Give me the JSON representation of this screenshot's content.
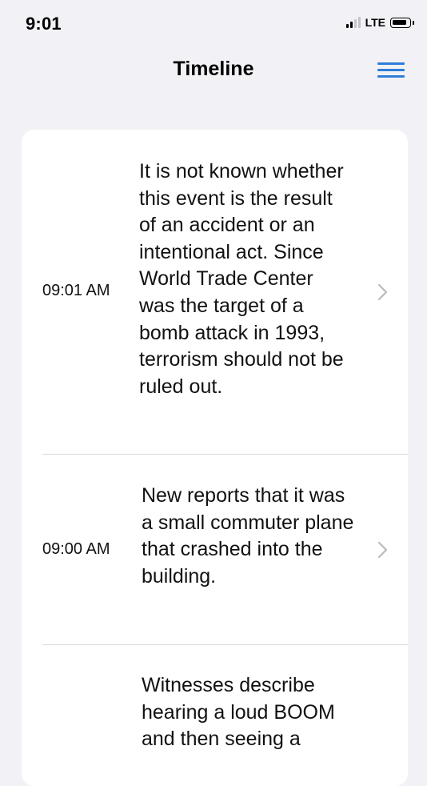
{
  "status_bar": {
    "time": "9:01",
    "network": "LTE"
  },
  "nav": {
    "title": "Timeline",
    "menu_icon": "hamburger-menu-icon",
    "accent_color": "#2f7ed8"
  },
  "timeline": {
    "entries": [
      {
        "time": "09:01 AM",
        "text": "It is not known whether this event is the result of an accident or an intentional act. Since World Trade Center was the target of a bomb attack in 1993, terrorism should not be ruled out."
      },
      {
        "time": "09:00 AM",
        "text": "New reports that it was a small commuter plane that crashed into the building."
      },
      {
        "time": "",
        "text": "Witnesses describe hearing a loud BOOM and then seeing a"
      }
    ]
  }
}
